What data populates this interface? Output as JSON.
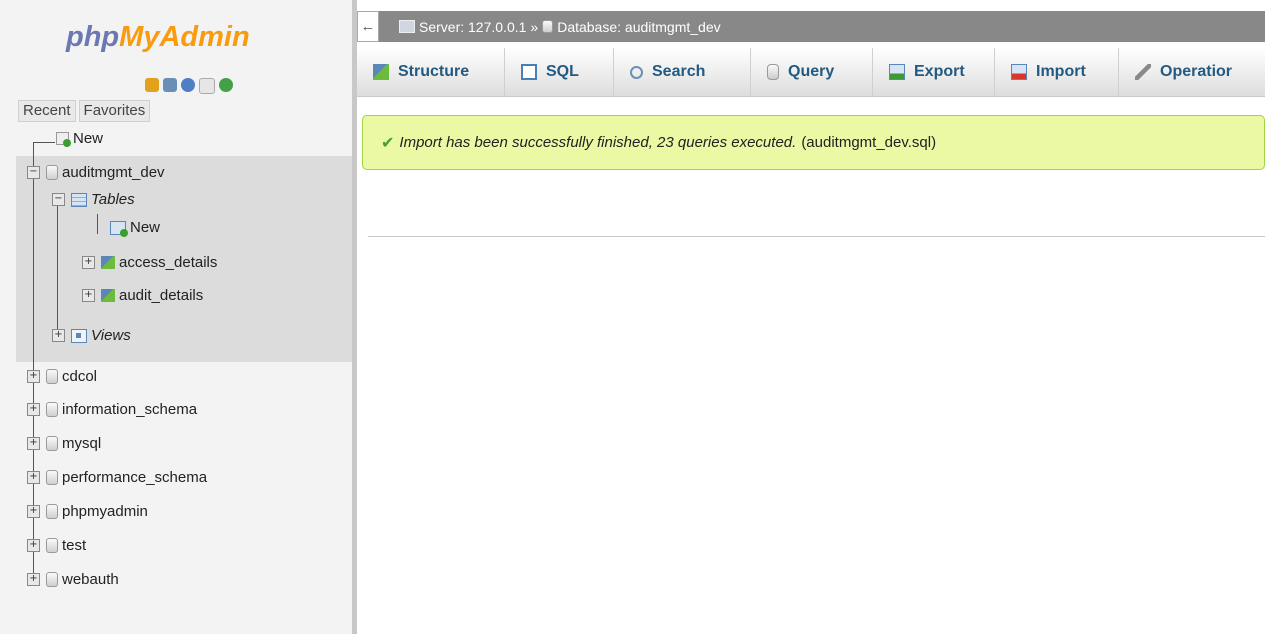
{
  "logo": {
    "php": "php",
    "my": "My",
    "admin": "Admin"
  },
  "header_icons": [
    "home-icon",
    "logout-icon",
    "help-icon",
    "docs-icon",
    "reload-icon"
  ],
  "nav_tabs": {
    "recent": "Recent",
    "favorites": "Favorites"
  },
  "tree": {
    "new_label": "New",
    "selected_db": "auditmgmt_dev",
    "tables_label": "Tables",
    "table_new_label": "New",
    "tables": [
      "access_details",
      "audit_details"
    ],
    "views_label": "Views",
    "databases": [
      "cdcol",
      "information_schema",
      "mysql",
      "performance_schema",
      "phpmyadmin",
      "test",
      "webauth"
    ]
  },
  "breadcrumb": {
    "back": "←",
    "server": "Server: 127.0.0.1",
    "sep": "»",
    "database": "Database: auditmgmt_dev"
  },
  "menu": [
    "Structure",
    "SQL",
    "Search",
    "Query",
    "Export",
    "Import",
    "Operatior"
  ],
  "notice": {
    "check": "✔",
    "message": "Import has been successfully finished, 23 queries executed.",
    "file": "(auditmgmt_dev.sql)"
  },
  "colors": {
    "logo_php": "#6c78af",
    "logo_my": "#f89c0e",
    "menu_text": "#235a81",
    "success_bg": "#ebf8a4",
    "success_border": "#a2d246"
  }
}
